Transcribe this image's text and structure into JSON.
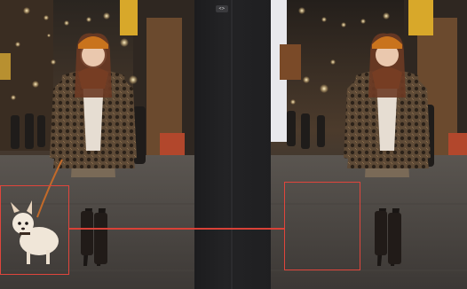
{
  "comparison": {
    "divider_label": "<>",
    "left_image": {
      "description_icon": "photo-before-edit-icon"
    },
    "right_image": {
      "description_icon": "photo-after-edit-icon"
    }
  },
  "annotations": {
    "accent_color": "#e0453c",
    "selection_icon": "dashed-selection-box-icon"
  }
}
